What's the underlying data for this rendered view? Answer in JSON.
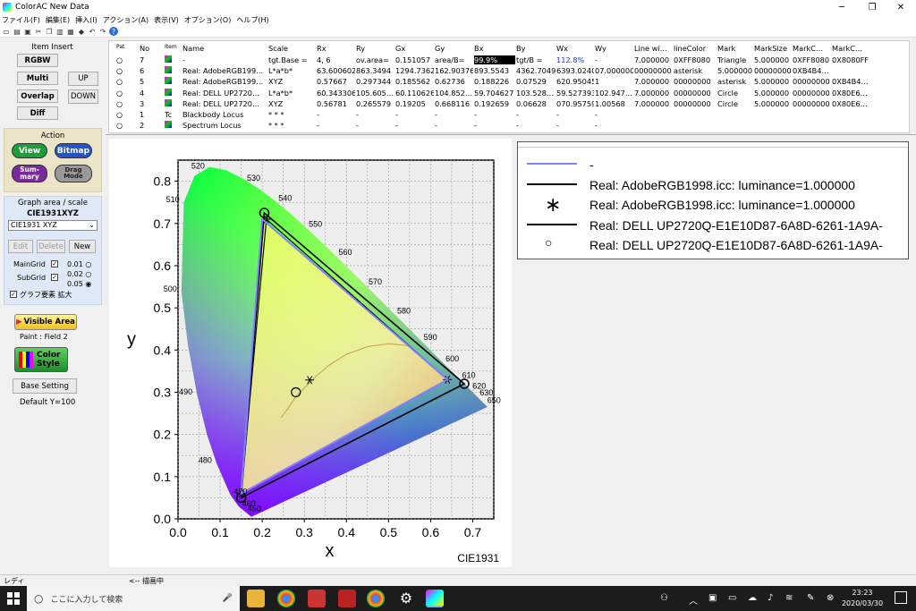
{
  "window": {
    "title": "ColorAC  New Data",
    "minimize": "─",
    "maximize": "❐",
    "close": "✕"
  },
  "menu": [
    "ファイル(F)",
    "編集(E)",
    "挿入(I)",
    "アクション(A)",
    "表示(V)",
    "オプション(O)",
    "ヘルプ(H)"
  ],
  "toolbar_icons": [
    "new-icon",
    "open-icon",
    "save-icon",
    "cut-icon",
    "copy-icon",
    "paste-icon",
    "print-icon",
    "color-icon",
    "undo-icon",
    "redo-icon",
    "help-icon"
  ],
  "left": {
    "item_insert": {
      "title": "Item Insert",
      "rgbw": "RGBW",
      "multi": "Multi",
      "overlap": "Overlap",
      "diff": "Diff",
      "up": "UP",
      "down": "DOWN"
    },
    "action": {
      "title": "Action",
      "view": "View",
      "bitmap": "Bitmap",
      "summary": "Sum-\nmary",
      "drag": "Drag\nMode"
    },
    "graph": {
      "title": "Graph area / scale",
      "name": "CIE1931XYZ",
      "select": "CIE1931 XYZ",
      "edit": "Edit",
      "delete": "Delete",
      "new": "New",
      "maingrid": "MainGrid",
      "subgrid": "SubGrid",
      "grid_opts": [
        "0.01",
        "0.02",
        "0.05"
      ],
      "enlarge": "グラフ要素 拡大"
    },
    "visible_area": "Visible Area",
    "paint": "Paint : Field 2",
    "color_style": "Color\nStyle",
    "base_setting": "Base Setting",
    "default_y": "Default Y=100"
  },
  "table": {
    "headers": [
      "Pat",
      "No",
      "Item",
      "Name",
      "Scale",
      "Rx",
      "Ry",
      "Gx",
      "Gy",
      "Bx",
      "By",
      "Wx",
      "Wy",
      "Line wi…",
      "lineColor",
      "Mark",
      "MarkSize",
      "MarkC…",
      "MarkC…"
    ],
    "rows": [
      [
        "○",
        "7",
        "icon",
        "-",
        "tgt.Base =",
        "4, 6",
        "ov.area=",
        "0.151057",
        "area/B=",
        "99.9%",
        "tgt/B =",
        "112.8%",
        "-",
        "7.000000",
        "0XFF8080",
        "Triangle",
        "5.000000",
        "0XFF8080",
        "0X8080FF"
      ],
      [
        "○",
        "6",
        "icon",
        "Real: AdobeRGB199…",
        "L*a*b*",
        "63.60060295.3983",
        "863.3494",
        "1294.73624",
        "162.90376",
        "893.5543",
        "4362.7049",
        "6393.02406",
        "07.000000",
        "00000000",
        "asterisk",
        "5.000000",
        "00000000",
        "0XB4B4…"
      ],
      [
        "○",
        "5",
        "icon",
        "Real: AdobeRGB199…",
        "XYZ",
        "0.57667",
        "0.297344",
        "0.185562",
        "0.62736",
        "0.188226",
        "0.07529",
        "620.950455",
        "1",
        "7.000000",
        "00000000",
        "asterisk",
        "5.000000",
        "00000000",
        "0XB4B4…"
      ],
      [
        "○",
        "4",
        "icon",
        "Real: DELL UP2720…",
        "L*a*b*",
        "60.343306",
        "105.605…",
        "60.110626",
        "104.852…",
        "59.704627",
        "103.528…",
        "59.527393",
        "102.947…",
        "7.000000",
        "00000000",
        "Circle",
        "5.000000",
        "00000000",
        "0X80E6…"
      ],
      [
        "○",
        "3",
        "icon",
        "Real: DELL UP2720…",
        "XYZ",
        "0.56781",
        "0.265579",
        "0.19205",
        "0.668116",
        "0.192659",
        "0.06628",
        "070.957591",
        "1.00568",
        "7.000000",
        "00000000",
        "Circle",
        "5.000000",
        "00000000",
        "0X80E6…"
      ],
      [
        "○",
        "1",
        "Tc",
        "Blackbody Locus",
        "* * *",
        "-",
        "-",
        "-",
        "-",
        "-",
        "-",
        "-",
        "-",
        "",
        "",
        "",
        "",
        "",
        ""
      ],
      [
        "○",
        "2",
        "icon",
        "Spectrum Locus",
        "* * *",
        "-",
        "-",
        "-",
        "-",
        "-",
        "-",
        "-",
        "-",
        "",
        "",
        "",
        "",
        "",
        ""
      ]
    ]
  },
  "chart_data": {
    "type": "scatter",
    "title": "",
    "xlabel": "x",
    "ylabel": "y",
    "footer": "CIE1931",
    "xlim": [
      0.0,
      0.75
    ],
    "ylim": [
      0.0,
      0.85
    ],
    "xticks": [
      "0.0",
      "0.1",
      "0.2",
      "0.3",
      "0.4",
      "0.5",
      "0.6",
      "0.7"
    ],
    "yticks": [
      "0.0",
      "0.1",
      "0.2",
      "0.3",
      "0.4",
      "0.5",
      "0.6",
      "0.7",
      "0.8"
    ],
    "wavelength_labels": [
      {
        "t": "520",
        "x": 0.074,
        "y": 0.834
      },
      {
        "t": "530",
        "x": 0.155,
        "y": 0.806
      },
      {
        "t": "540",
        "x": 0.23,
        "y": 0.754
      },
      {
        "t": "550",
        "x": 0.302,
        "y": 0.692
      },
      {
        "t": "560",
        "x": 0.373,
        "y": 0.625
      },
      {
        "t": "570",
        "x": 0.444,
        "y": 0.555
      },
      {
        "t": "580",
        "x": 0.512,
        "y": 0.487
      },
      {
        "t": "590",
        "x": 0.575,
        "y": 0.424
      },
      {
        "t": "600",
        "x": 0.627,
        "y": 0.373
      },
      {
        "t": "610",
        "x": 0.666,
        "y": 0.334
      },
      {
        "t": "620",
        "x": 0.691,
        "y": 0.308
      },
      {
        "t": "630",
        "x": 0.708,
        "y": 0.292
      },
      {
        "t": "650",
        "x": 0.726,
        "y": 0.274
      },
      {
        "t": "510",
        "x": 0.014,
        "y": 0.75
      },
      {
        "t": "500",
        "x": 0.008,
        "y": 0.538
      },
      {
        "t": "490",
        "x": 0.045,
        "y": 0.295
      },
      {
        "t": "480",
        "x": 0.091,
        "y": 0.133
      },
      {
        "t": "470",
        "x": 0.124,
        "y": 0.058
      },
      {
        "t": "460",
        "x": 0.144,
        "y": 0.03
      },
      {
        "t": "450",
        "x": 0.157,
        "y": 0.018
      }
    ],
    "spectrum_locus": [
      [
        0.1741,
        0.005
      ],
      [
        0.144,
        0.0297
      ],
      [
        0.1241,
        0.0578
      ],
      [
        0.0913,
        0.1327
      ],
      [
        0.0687,
        0.2007
      ],
      [
        0.0454,
        0.295
      ],
      [
        0.0235,
        0.4127
      ],
      [
        0.0082,
        0.5384
      ],
      [
        0.0139,
        0.7502
      ],
      [
        0.0389,
        0.812
      ],
      [
        0.0743,
        0.8338
      ],
      [
        0.1142,
        0.8262
      ],
      [
        0.1547,
        0.8059
      ],
      [
        0.1929,
        0.7816
      ],
      [
        0.2296,
        0.7543
      ],
      [
        0.2658,
        0.7243
      ],
      [
        0.3016,
        0.6923
      ],
      [
        0.3373,
        0.6589
      ],
      [
        0.3731,
        0.6245
      ],
      [
        0.4087,
        0.5896
      ],
      [
        0.4441,
        0.5547
      ],
      [
        0.4788,
        0.5202
      ],
      [
        0.5125,
        0.4866
      ],
      [
        0.5448,
        0.4544
      ],
      [
        0.5752,
        0.4242
      ],
      [
        0.6029,
        0.3965
      ],
      [
        0.627,
        0.3725
      ],
      [
        0.6482,
        0.3514
      ],
      [
        0.6658,
        0.334
      ],
      [
        0.6801,
        0.3197
      ],
      [
        0.6915,
        0.3083
      ],
      [
        0.7006,
        0.2993
      ],
      [
        0.7079,
        0.292
      ],
      [
        0.714,
        0.2859
      ],
      [
        0.719,
        0.2809
      ],
      [
        0.723,
        0.277
      ],
      [
        0.726,
        0.274
      ],
      [
        0.7347,
        0.2653
      ]
    ],
    "series": [
      {
        "name": "-",
        "color": "#8080ff",
        "points": [
          [
            0.2,
            0.71
          ],
          [
            0.64,
            0.33
          ],
          [
            0.15,
            0.06
          ]
        ]
      },
      {
        "name": "Real: AdobeRGB1998.icc: luminance=1.000000",
        "color": "#000000",
        "marker": "asterisk",
        "points": [
          [
            0.21,
            0.71
          ],
          [
            0.64,
            0.33
          ],
          [
            0.15,
            0.06
          ]
        ],
        "white": [
          0.3127,
          0.329
        ]
      },
      {
        "name": "Real: DELL UP2720Q-E1E10D87-6A8D-6261-1A9A-",
        "color": "#000000",
        "marker": "circle",
        "points": [
          [
            0.205,
            0.725
          ],
          [
            0.68,
            0.32
          ],
          [
            0.15,
            0.05
          ]
        ],
        "white": [
          0.28,
          0.3
        ]
      }
    ],
    "legend": [
      "-",
      "Real: AdobeRGB1998.icc: luminance=1.000000",
      "Real: AdobeRGB1998.icc: luminance=1.000000",
      "Real: DELL UP2720Q-E1E10D87-6A8D-6261-1A9A-",
      "Real: DELL UP2720Q-E1E10D87-6A8D-6261-1A9A-"
    ],
    "legend_markers": [
      "line-blue",
      "line-black",
      "asterisk",
      "line-black",
      "circle"
    ]
  },
  "status": {
    "left": "レディ",
    "mid": "<-- 描画中"
  },
  "taskbar": {
    "search": "ここに入力して検索",
    "time": "23:23",
    "date": "2020/03/30"
  }
}
